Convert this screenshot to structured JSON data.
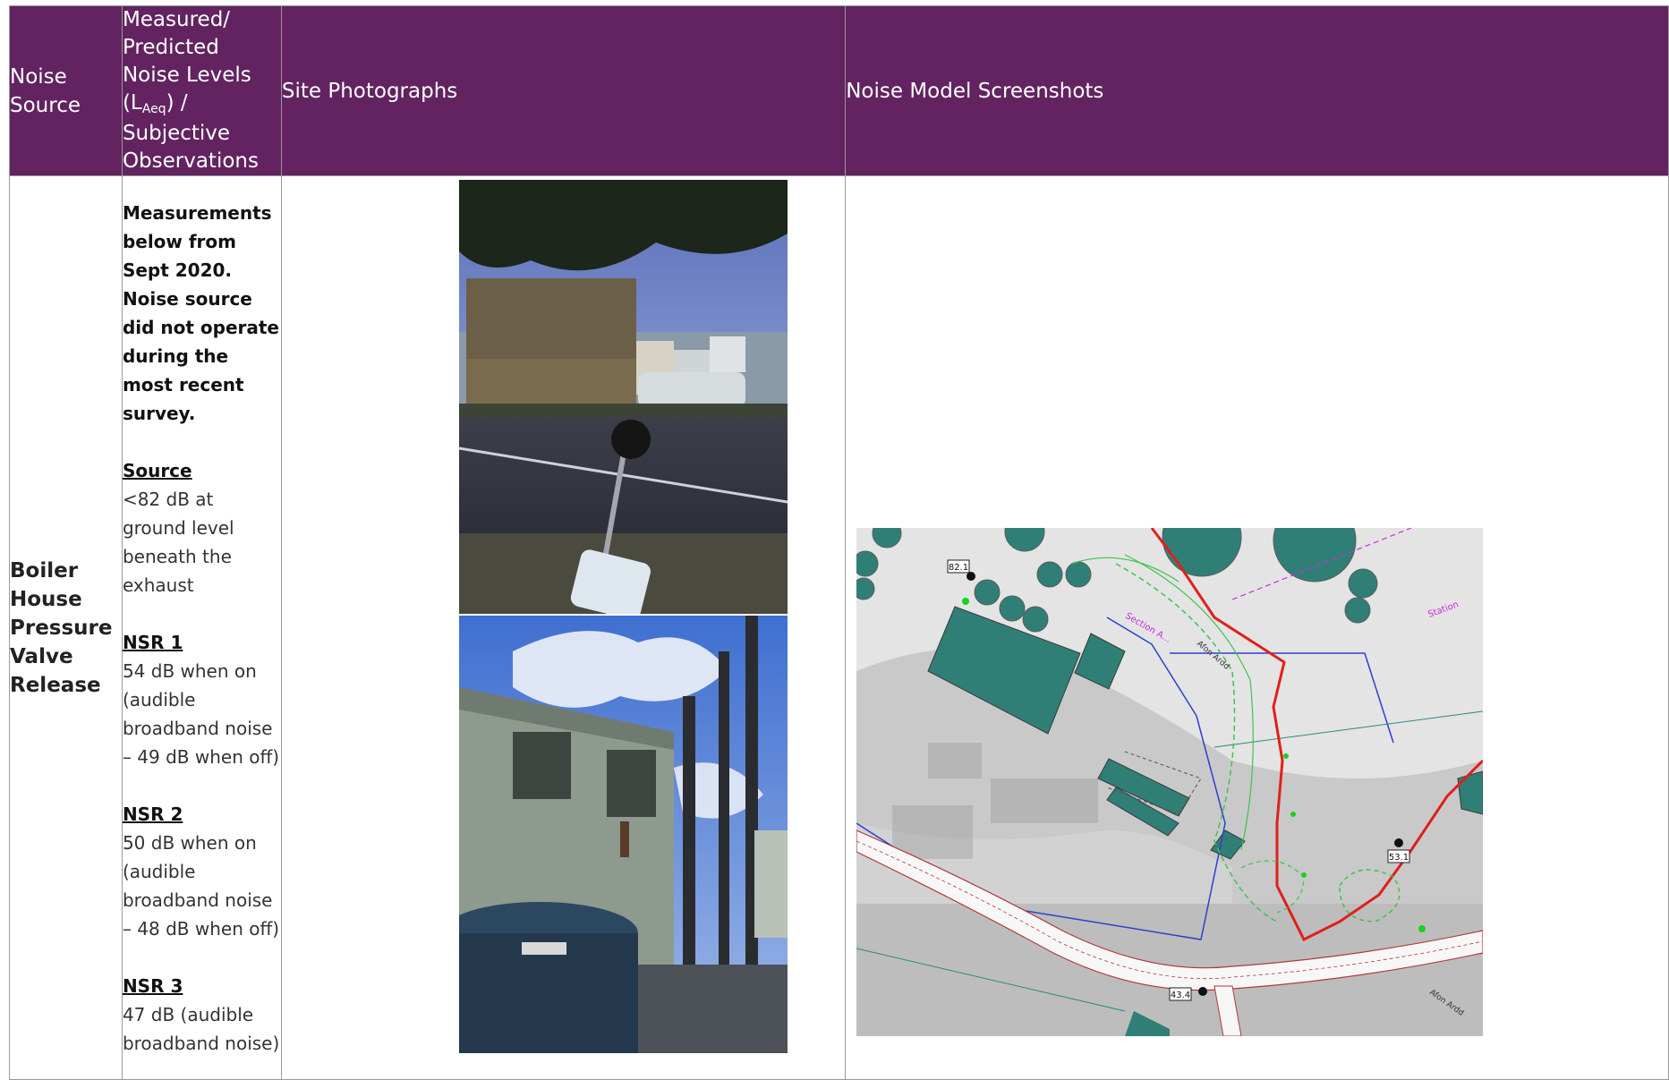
{
  "header": {
    "col1": "Noise Source",
    "col2_pre": "Measured/ Predicted Noise Levels (L",
    "col2_sub": "Aeq",
    "col2_post": ") / Subjective Observations",
    "col3": "Site Photographs",
    "col4": "Noise Model Screenshots"
  },
  "row": {
    "source": "Boiler House Pressure Valve Release",
    "intro": "Measurements below from Sept 2020.  Noise source did not operate during the most recent survey.",
    "blocks": [
      {
        "heading": "Source",
        "text": "<82 dB at ground level beneath the exhaust"
      },
      {
        "heading": "NSR 1",
        "text": "54 dB when on (audible broadband noise – 49 dB when off)"
      },
      {
        "heading": "NSR 2",
        "text": "50 dB when on (audible broadband noise – 48 dB when off)"
      },
      {
        "heading": "NSR 3",
        "text": "47 dB (audible broadband noise)"
      }
    ]
  },
  "map_labels": {
    "receiver_1": "82.1",
    "receiver_2": "53.1",
    "receiver_3": "43.4",
    "text_a": "Section A...",
    "text_b": "Station",
    "text_c": "Afon Ardd",
    "text_d": "Afon Ardd"
  },
  "colors": {
    "header_bg": "#622360",
    "building": "#2f7f76",
    "red_route": "#e0201a"
  }
}
